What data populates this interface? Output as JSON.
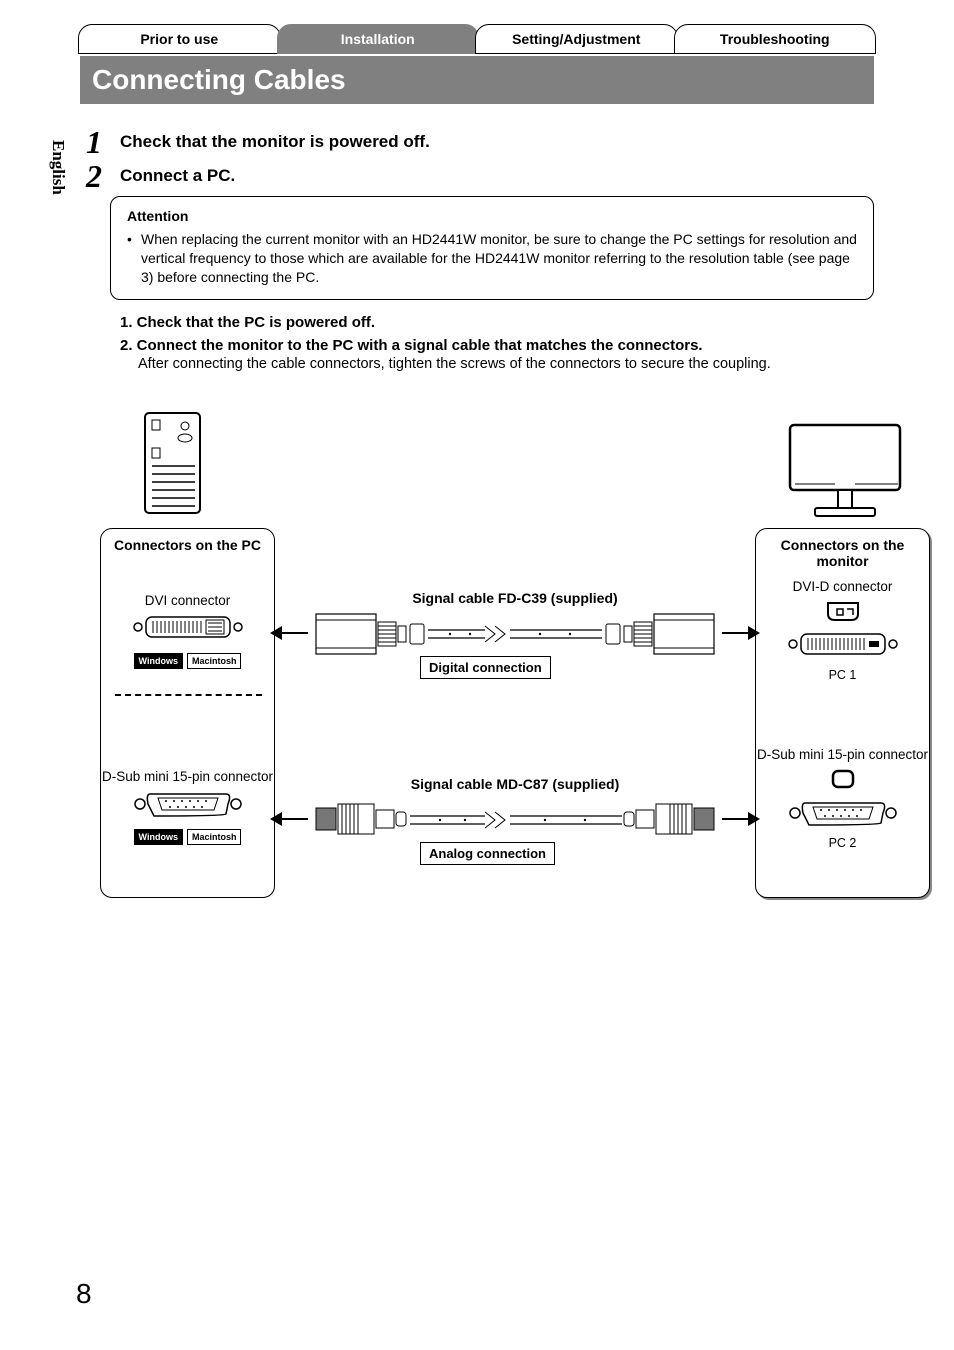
{
  "language_tab": "English",
  "nav": {
    "tabs": [
      "Prior to use",
      "Installation",
      "Setting/Adjustment",
      "Troubleshooting"
    ]
  },
  "section_title": "Connecting Cables",
  "steps": [
    {
      "num": "1",
      "title": "Check that the monitor is powered off."
    },
    {
      "num": "2",
      "title": "Connect a PC."
    }
  ],
  "attention": {
    "label": "Attention",
    "text": "When replacing the current monitor with an HD2441W monitor, be sure to change the PC settings for resolution and vertical frequency to those which are available for the HD2441W monitor referring to the resolution table (see page 3) before connecting the PC."
  },
  "substeps": {
    "s1": "1. Check that the PC is powered off.",
    "s2_title": "2. Connect the monitor to the PC with a signal cable that matches the connectors.",
    "s2_note": "After connecting the cable connectors, tighten the screws of the connectors to secure the coupling."
  },
  "diagram": {
    "left_panel_title": "Connectors on the PC",
    "right_panel_title": "Connectors on the monitor",
    "dvi_left": "DVI connector",
    "dvi_right": "DVI-D connector",
    "dsub_left": "D-Sub mini 15-pin connector",
    "dsub_right": "D-Sub mini 15-pin connector",
    "pc1": "PC 1",
    "pc2": "PC 2",
    "os_win": "Windows",
    "os_mac": "Macintosh",
    "cable1": "Signal cable FD-C39 (supplied)",
    "cable2": "Signal cable MD-C87 (supplied)",
    "tag1": "Digital connection",
    "tag2": "Analog connection"
  },
  "page_number": "8"
}
